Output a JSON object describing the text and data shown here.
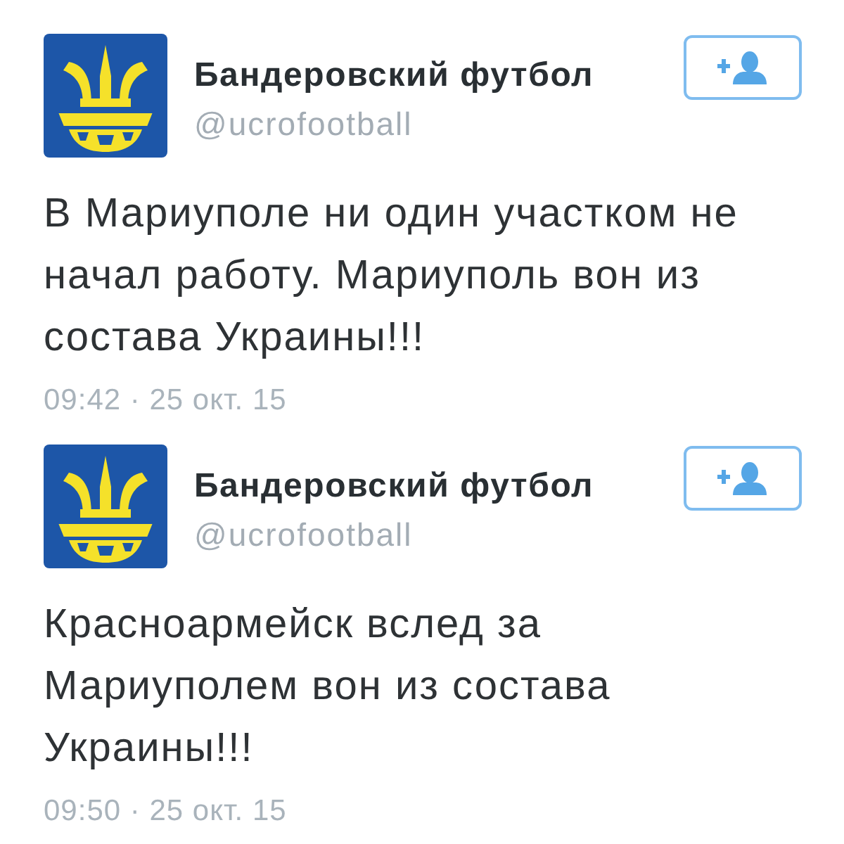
{
  "tweets": [
    {
      "author": {
        "name": "Бандеровский футбол",
        "handle": "@ucrofootball"
      },
      "text": "В Мариуполе ни один участком не начал работу. Мариуполь вон из состава Украины!!!",
      "timestamp": "09:42 · 25 окт. 15"
    },
    {
      "author": {
        "name": "Бандеровский футбол",
        "handle": "@ucrofootball"
      },
      "text": "Красноармейск вслед за Мариуполем вон из состава Украины!!!",
      "timestamp": "09:50 · 25 окт. 15"
    }
  ]
}
